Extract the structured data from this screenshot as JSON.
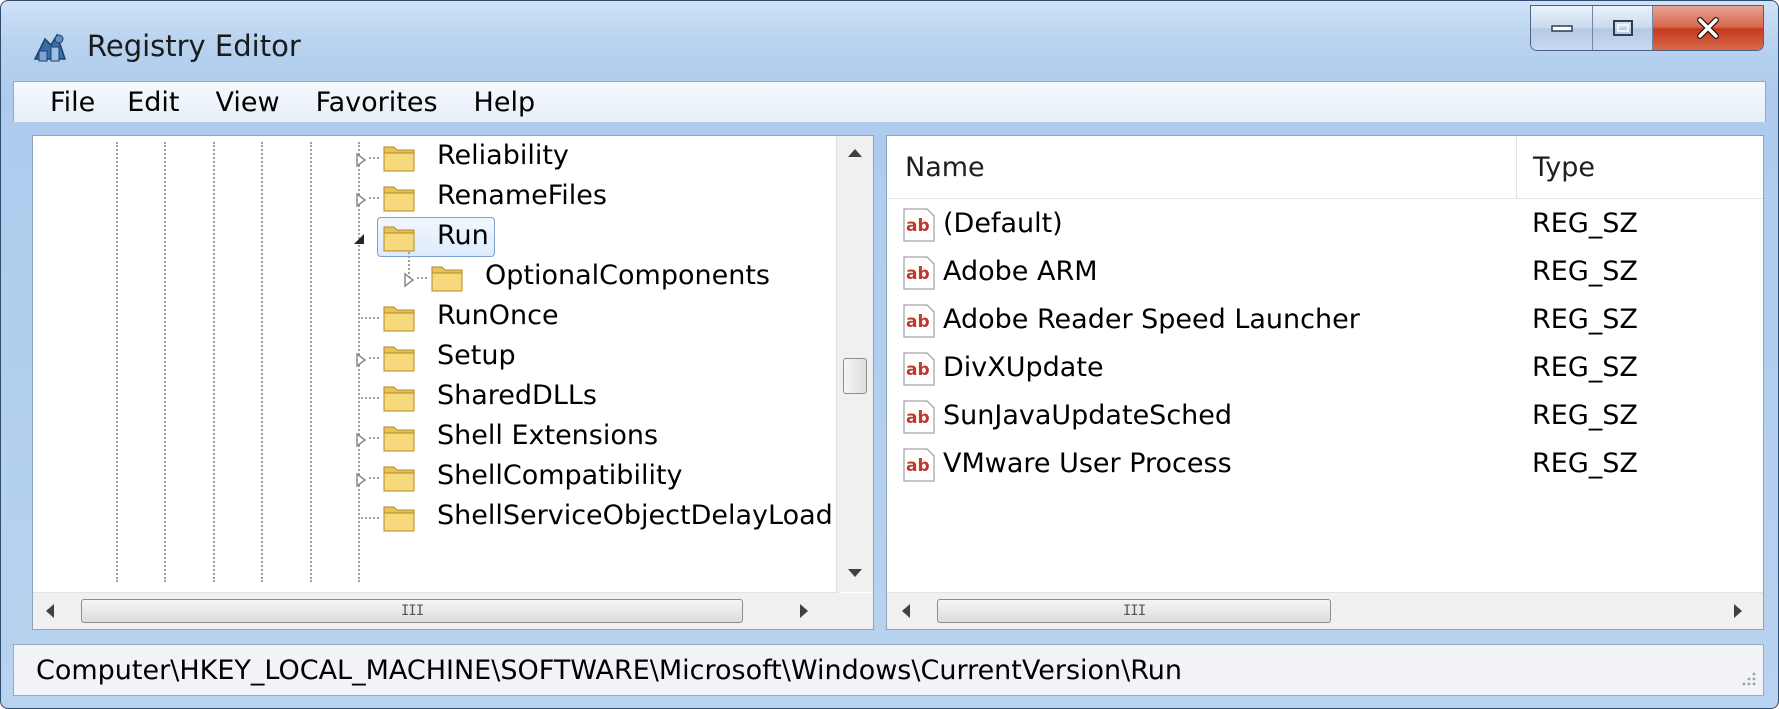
{
  "window": {
    "title": "Registry Editor",
    "app_icon": "registry-editor-icon",
    "caption_buttons": [
      "minimize-icon",
      "maximize-icon",
      "close-icon"
    ]
  },
  "menu": {
    "items": [
      "File",
      "Edit",
      "View",
      "Favorites",
      "Help"
    ]
  },
  "tree": {
    "nodes": [
      {
        "label": "Reliability",
        "expander": "collapsed"
      },
      {
        "label": "RenameFiles",
        "expander": "collapsed"
      },
      {
        "label": "Run",
        "expander": "expanded",
        "selected": true
      },
      {
        "label": "OptionalComponents",
        "expander": "collapsed",
        "child": true
      },
      {
        "label": "RunOnce",
        "expander": "none"
      },
      {
        "label": "Setup",
        "expander": "collapsed"
      },
      {
        "label": "SharedDLLs",
        "expander": "none"
      },
      {
        "label": "Shell Extensions",
        "expander": "collapsed"
      },
      {
        "label": "ShellCompatibility",
        "expander": "collapsed"
      },
      {
        "label": "ShellServiceObjectDelayLoad",
        "expander": "none"
      }
    ],
    "hscroll_grip": "III"
  },
  "list": {
    "columns": [
      "Name",
      "Type"
    ],
    "rows": [
      {
        "name": "(Default)",
        "type": "REG_SZ",
        "icon": "string-value-icon"
      },
      {
        "name": "Adobe ARM",
        "type": "REG_SZ",
        "icon": "string-value-icon"
      },
      {
        "name": "Adobe Reader Speed Launcher",
        "type": "REG_SZ",
        "icon": "string-value-icon"
      },
      {
        "name": "DivXUpdate",
        "type": "REG_SZ",
        "icon": "string-value-icon"
      },
      {
        "name": "SunJavaUpdateSched",
        "type": "REG_SZ",
        "icon": "string-value-icon"
      },
      {
        "name": "VMware User Process",
        "type": "REG_SZ",
        "icon": "string-value-icon"
      }
    ],
    "icon_text": "ab",
    "hscroll_grip": "III"
  },
  "status": {
    "path": "Computer\\HKEY_LOCAL_MACHINE\\SOFTWARE\\Microsoft\\Windows\\CurrentVersion\\Run"
  },
  "colors": {
    "folder": "#e8c15a",
    "selection_border": "#7da2ce",
    "close_button": "#c53b1e",
    "string_icon_text": "#c0392b"
  }
}
